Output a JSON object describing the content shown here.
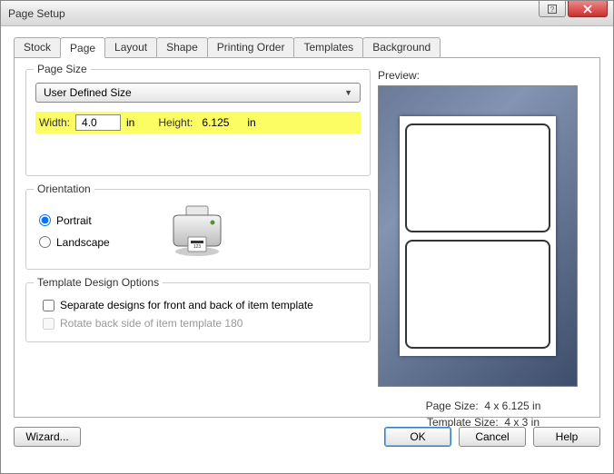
{
  "window": {
    "title": "Page Setup"
  },
  "tabs": [
    "Stock",
    "Page",
    "Layout",
    "Shape",
    "Printing Order",
    "Templates",
    "Background"
  ],
  "active_tab": "Page",
  "pageSize": {
    "group_title": "Page Size",
    "select_value": "User Defined Size",
    "width_label": "Width:",
    "width_value": "4.0",
    "width_unit": "in",
    "height_label": "Height:",
    "height_value": "6.125",
    "height_unit": "in"
  },
  "orientation": {
    "group_title": "Orientation",
    "portrait_label": "Portrait",
    "landscape_label": "Landscape",
    "selected": "portrait"
  },
  "templateOptions": {
    "group_title": "Template Design Options",
    "separate_label": "Separate designs for front and back of item template",
    "rotate_label": "Rotate back side of item template 180"
  },
  "preview": {
    "label": "Preview:",
    "page_size_label": "Page Size:",
    "page_size_value": "4 x 6.125 in",
    "template_size_label": "Template Size:",
    "template_size_value": "4 x 3 in"
  },
  "buttons": {
    "wizard": "Wizard...",
    "ok": "OK",
    "cancel": "Cancel",
    "help": "Help"
  }
}
